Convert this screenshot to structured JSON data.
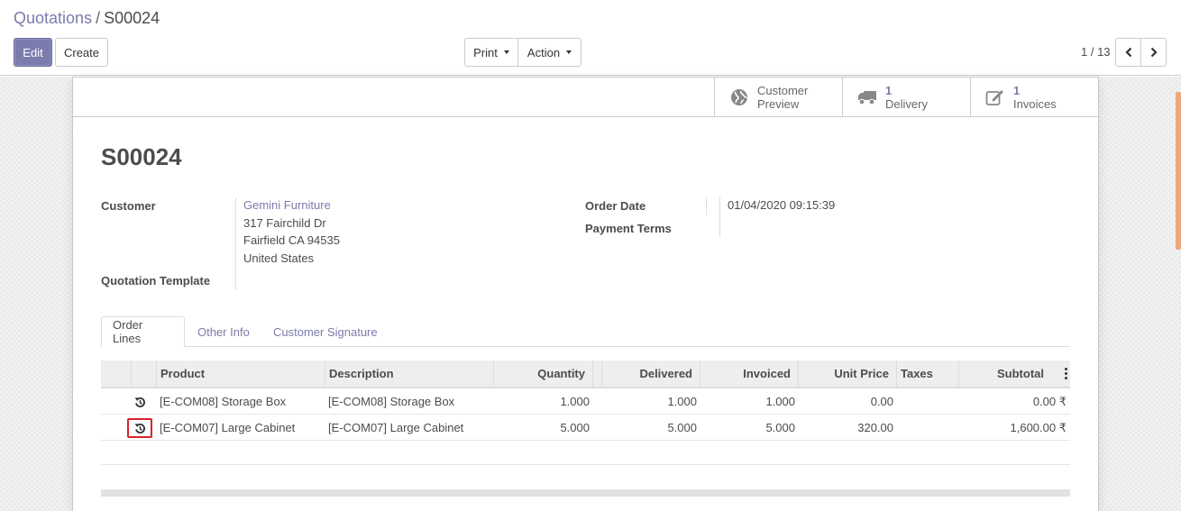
{
  "breadcrumb": {
    "parent": "Quotations",
    "separator": "/",
    "current": "S00024"
  },
  "toolbar": {
    "edit": "Edit",
    "create": "Create",
    "print": "Print",
    "action": "Action"
  },
  "pager": {
    "value": "1 / 13"
  },
  "smart_buttons": [
    {
      "icon": "globe-icon",
      "count": "",
      "label_line1": "Customer",
      "label_line2": "Preview"
    },
    {
      "icon": "truck-icon",
      "count": "1",
      "label_line1": "",
      "label_line2": "Delivery"
    },
    {
      "icon": "pencil-square-icon",
      "count": "1",
      "label_line1": "",
      "label_line2": "Invoices"
    }
  ],
  "record": {
    "title": "S00024",
    "customer_label": "Customer",
    "customer_name": "Gemini Furniture",
    "address_line1": "317 Fairchild Dr",
    "address_line2": "Fairfield CA 94535",
    "address_line3": "United States",
    "quotation_template_label": "Quotation Template",
    "order_date_label": "Order Date",
    "order_date": "01/04/2020 09:15:39",
    "payment_terms_label": "Payment Terms"
  },
  "tabs": [
    "Order Lines",
    "Other Info",
    "Customer Signature"
  ],
  "table": {
    "headers": [
      "Product",
      "Description",
      "Quantity",
      "Delivered",
      "Invoiced",
      "Unit Price",
      "Taxes",
      "Subtotal"
    ],
    "rows": [
      {
        "product": "[E-COM08] Storage Box",
        "description": "[E-COM08] Storage Box",
        "quantity": "1.000",
        "delivered": "1.000",
        "invoiced": "1.000",
        "unit_price": "0.00",
        "taxes": "",
        "subtotal": "0.00 ₹"
      },
      {
        "product": "[E-COM07] Large Cabinet",
        "description": "[E-COM07] Large Cabinet",
        "quantity": "5.000",
        "delivered": "5.000",
        "invoiced": "5.000",
        "unit_price": "320.00",
        "taxes": "",
        "subtotal": "1,600.00 ₹"
      }
    ]
  },
  "colors": {
    "brand": "#7c7bad",
    "highlight": "#d9232d",
    "scrollbar": "#f0a57d"
  }
}
